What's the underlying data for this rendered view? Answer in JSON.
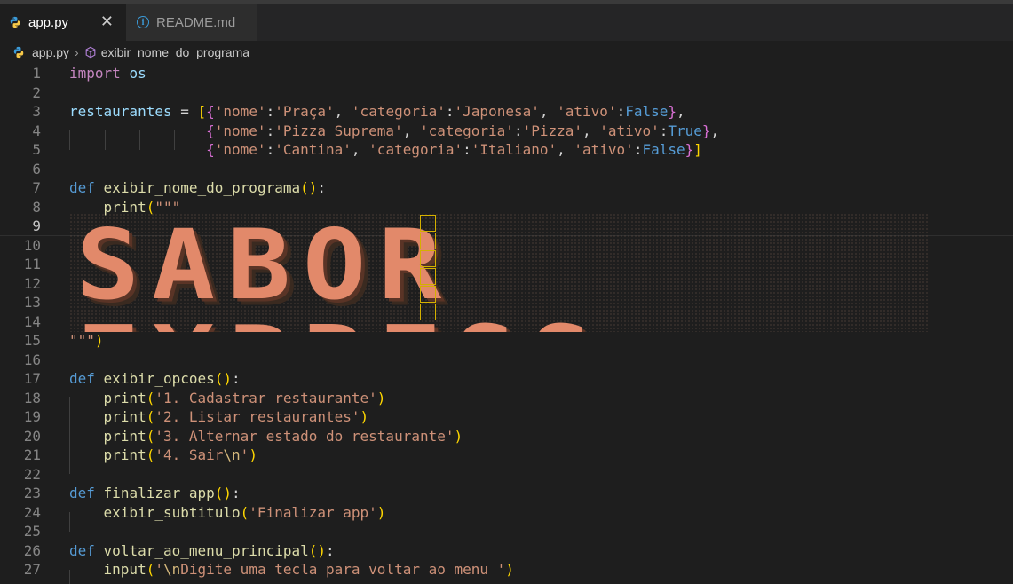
{
  "tabs": [
    {
      "label": "app.py",
      "active": true,
      "icon": "python-icon"
    },
    {
      "label": "README.md",
      "active": false,
      "icon": "info-icon"
    }
  ],
  "breadcrumb": {
    "file": "app.py",
    "symbol": "exibir_nome_do_programa"
  },
  "banner_text": "SABOR EXPRESS",
  "line_numbers": [
    "1",
    "2",
    "3",
    "4",
    "5",
    "6",
    "7",
    "8",
    "9",
    "10",
    "11",
    "12",
    "13",
    "14",
    "15",
    "16",
    "17",
    "18",
    "19",
    "20",
    "21",
    "22",
    "23",
    "24",
    "25",
    "26",
    "27"
  ],
  "code": {
    "l1_kw": "import",
    "l1_mod": "os",
    "l3_var": "restaurantes",
    "s_nome": "'nome'",
    "s_categoria": "'categoria'",
    "s_ativo": "'ativo'",
    "l3_nome": "'Praça'",
    "l3_cat": "'Japonesa'",
    "l3_val": "False",
    "l4_nome": "'Pizza Suprema'",
    "l4_cat": "'Pizza'",
    "l4_val": "True",
    "l5_nome": "'Cantina'",
    "l5_cat": "'Italiano'",
    "l5_val": "False",
    "def": "def",
    "l7_fn": "exibir_nome_do_programa",
    "print": "print",
    "triple": "\"\"\"",
    "l17_fn": "exibir_opcoes",
    "l18_str": "'1. Cadastrar restaurante'",
    "l19_str": "'2. Listar restaurantes'",
    "l20_str": "'3. Alternar estado do restaurante'",
    "l21_str_a": "'4. Sair",
    "l21_esc": "\\n",
    "l21_str_b": "'",
    "l23_fn": "finalizar_app",
    "l24_fn": "exibir_subtitulo",
    "l24_str": "'Finalizar app'",
    "l26_fn": "voltar_ao_menu_principal",
    "l27_fn": "input",
    "l27_esc": "\\n",
    "l27_str": "Digite uma tecla para voltar ao menu '"
  },
  "colors": {
    "accent": "#e2896a",
    "keyword": "#c586c0",
    "string": "#ce9178",
    "function": "#dcdcaa"
  }
}
